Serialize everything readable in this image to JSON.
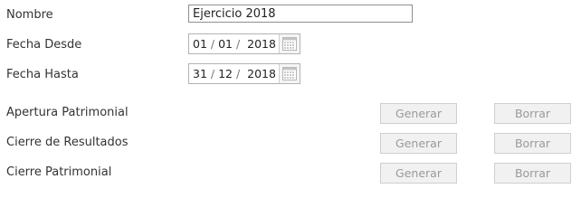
{
  "form": {
    "nombre_label": "Nombre",
    "nombre_value": "Ejercicio 2018",
    "fecha_desde_label": "Fecha Desde",
    "fecha_desde": {
      "day": "01",
      "month": "01",
      "year": "2018"
    },
    "fecha_hasta_label": "Fecha Hasta",
    "fecha_hasta": {
      "day": "31",
      "month": "12",
      "year": "2018"
    },
    "date_separator": "/",
    "calendar_icon": "calendar-icon"
  },
  "actions": [
    {
      "label": "Apertura Patrimonial",
      "generate_label": "Generar",
      "delete_label": "Borrar"
    },
    {
      "label": "Cierre de Resultados",
      "generate_label": "Generar",
      "delete_label": "Borrar"
    },
    {
      "label": "Cierre Patrimonial",
      "generate_label": "Generar",
      "delete_label": "Borrar"
    }
  ]
}
